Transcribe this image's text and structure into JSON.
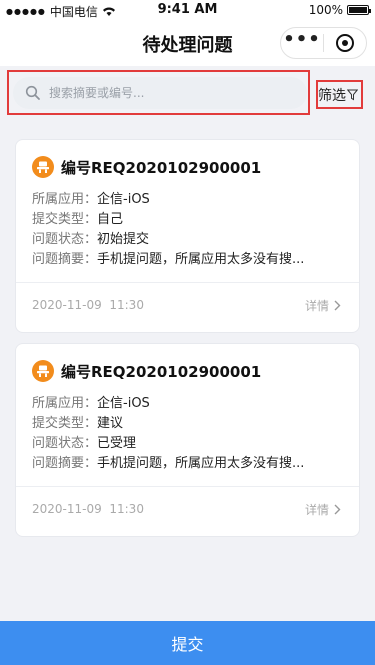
{
  "status_bar": {
    "carrier": "中国电信",
    "time": "9:41 AM",
    "battery": "100%"
  },
  "nav": {
    "title": "待处理问题"
  },
  "search": {
    "placeholder": "搜索摘要或编号...",
    "value": ""
  },
  "filter": {
    "label": "筛选"
  },
  "cards": [
    {
      "id": "编号REQ2020102900001",
      "app_label": "所属应用：",
      "app": "企信-iOS",
      "type_label": "提交类型：",
      "type": "自己",
      "status_label": "问题状态：",
      "status": "初始提交",
      "summary_label": "问题摘要：",
      "summary": "手机提问题，所属应用太多没有搜...",
      "date": "2020-11-09  11:30",
      "detail": "详情"
    },
    {
      "id": "编号REQ2020102900001",
      "app_label": "所属应用：",
      "app": "企信-iOS",
      "type_label": "提交类型：",
      "type": "建议",
      "status_label": "问题状态：",
      "status": "已受理",
      "summary_label": "问题摘要：",
      "summary": "手机提问题，所属应用太多没有搜...",
      "date": "2020-11-09  11:30",
      "detail": "详情"
    }
  ],
  "submit": {
    "label": "提交"
  },
  "colors": {
    "accent": "#3d8ef0",
    "badge": "#f28c1c",
    "highlight": "#e23b3b"
  }
}
